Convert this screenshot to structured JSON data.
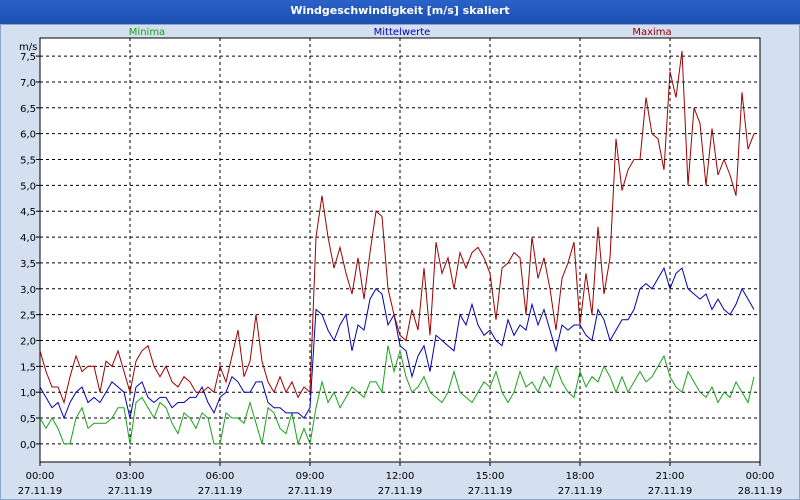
{
  "window": {
    "title": "Windgeschwindigkeit [m/s] skaliert"
  },
  "colors": {
    "minima": "#1aa31a",
    "mittelwerte": "#0000b8",
    "maxima": "#a00000",
    "grid": "#000000",
    "plot_bg": "#ffffff"
  },
  "chart_data": {
    "type": "line",
    "title": "Windgeschwindigkeit [m/s] skaliert",
    "ylabel": "m/s",
    "ylim": [
      -0.35,
      7.85
    ],
    "xlim": [
      0,
      24
    ],
    "yticks": [
      {
        "v": 0,
        "label": "0,0"
      },
      {
        "v": 0.5,
        "label": "0,5"
      },
      {
        "v": 1,
        "label": "1,0"
      },
      {
        "v": 1.5,
        "label": "1,5"
      },
      {
        "v": 2,
        "label": "2,0"
      },
      {
        "v": 2.5,
        "label": "2,5"
      },
      {
        "v": 3,
        "label": "3,0"
      },
      {
        "v": 3.5,
        "label": "3,5"
      },
      {
        "v": 4,
        "label": "4,0"
      },
      {
        "v": 4.5,
        "label": "4,5"
      },
      {
        "v": 5,
        "label": "5,0"
      },
      {
        "v": 5.5,
        "label": "5,5"
      },
      {
        "v": 6,
        "label": "6,0"
      },
      {
        "v": 6.5,
        "label": "6,5"
      },
      {
        "v": 7,
        "label": "7,0"
      },
      {
        "v": 7.5,
        "label": "7,5"
      }
    ],
    "xticks": [
      {
        "h": 0,
        "time": "00:00",
        "date": "27.11.19"
      },
      {
        "h": 3,
        "time": "03:00",
        "date": "27.11.19"
      },
      {
        "h": 6,
        "time": "06:00",
        "date": "27.11.19"
      },
      {
        "h": 9,
        "time": "09:00",
        "date": "27.11.19"
      },
      {
        "h": 12,
        "time": "12:00",
        "date": "27.11.19"
      },
      {
        "h": 15,
        "time": "15:00",
        "date": "27.11.19"
      },
      {
        "h": 18,
        "time": "18:00",
        "date": "27.11.19"
      },
      {
        "h": 21,
        "time": "21:00",
        "date": "27.11.19"
      },
      {
        "h": 24,
        "time": "00:00",
        "date": "28.11.19"
      }
    ],
    "grid": true,
    "series": [
      {
        "name": "Minima",
        "color": "#1aa31a",
        "legend_position": "left",
        "x": [
          0,
          0.2,
          0.4,
          0.6,
          0.8,
          1.0,
          1.2,
          1.4,
          1.6,
          1.8,
          2.0,
          2.2,
          2.4,
          2.6,
          2.8,
          3.0,
          3.2,
          3.4,
          3.6,
          3.8,
          4.0,
          4.2,
          4.4,
          4.6,
          4.8,
          5.0,
          5.2,
          5.4,
          5.6,
          5.8,
          6.0,
          6.2,
          6.4,
          6.6,
          6.8,
          7.0,
          7.2,
          7.4,
          7.6,
          7.8,
          8.0,
          8.2,
          8.4,
          8.6,
          8.8,
          9.0,
          9.2,
          9.4,
          9.6,
          9.8,
          10.0,
          10.2,
          10.4,
          10.6,
          10.8,
          11.0,
          11.2,
          11.4,
          11.6,
          11.8,
          12.0,
          12.2,
          12.4,
          12.6,
          12.8,
          13.0,
          13.2,
          13.4,
          13.6,
          13.8,
          14.0,
          14.2,
          14.4,
          14.6,
          14.8,
          15.0,
          15.2,
          15.4,
          15.6,
          15.8,
          16.0,
          16.2,
          16.4,
          16.6,
          16.8,
          17.0,
          17.2,
          17.4,
          17.6,
          17.8,
          18.0,
          18.2,
          18.4,
          18.6,
          18.8,
          19.0,
          19.2,
          19.4,
          19.6,
          19.8,
          20.0,
          20.2,
          20.4,
          20.6,
          20.8,
          21.0,
          21.2,
          21.4,
          21.6,
          21.8,
          22.0,
          22.2,
          22.4,
          22.6,
          22.8,
          23.0,
          23.2,
          23.4,
          23.6,
          23.8
        ],
        "values": [
          0.5,
          0.3,
          0.5,
          0.3,
          0.0,
          0.0,
          0.5,
          0.7,
          0.3,
          0.4,
          0.4,
          0.4,
          0.5,
          0.7,
          0.7,
          0.0,
          0.8,
          0.9,
          0.7,
          0.5,
          0.8,
          0.7,
          0.4,
          0.2,
          0.6,
          0.5,
          0.3,
          0.6,
          0.5,
          0.0,
          0.0,
          0.6,
          0.5,
          0.5,
          0.4,
          0.8,
          0.4,
          0.0,
          0.7,
          0.6,
          0.3,
          0.2,
          0.6,
          0.0,
          0.3,
          0.0,
          0.7,
          1.2,
          0.8,
          1.0,
          0.7,
          0.9,
          1.1,
          1.0,
          0.9,
          1.2,
          1.2,
          1.0,
          1.9,
          1.4,
          1.8,
          1.3,
          1.0,
          1.1,
          1.3,
          1.0,
          0.9,
          0.8,
          1.0,
          1.4,
          1.0,
          0.9,
          0.8,
          1.0,
          1.2,
          1.1,
          1.4,
          1.0,
          0.8,
          1.0,
          1.4,
          1.1,
          1.2,
          1.0,
          1.3,
          1.1,
          1.5,
          1.2,
          1.0,
          0.9,
          1.4,
          1.1,
          1.3,
          1.2,
          1.5,
          1.3,
          1.0,
          1.3,
          1.0,
          1.2,
          1.4,
          1.2,
          1.3,
          1.5,
          1.7,
          1.3,
          1.1,
          1.0,
          1.4,
          1.2,
          1.0,
          0.9,
          1.1,
          0.8,
          1.0,
          0.9,
          1.2,
          1.0,
          0.8,
          1.3
        ]
      },
      {
        "name": "Mittelwerte",
        "color": "#0000b8",
        "legend_position": "center",
        "x": [
          0,
          0.2,
          0.4,
          0.6,
          0.8,
          1.0,
          1.2,
          1.4,
          1.6,
          1.8,
          2.0,
          2.2,
          2.4,
          2.6,
          2.8,
          3.0,
          3.2,
          3.4,
          3.6,
          3.8,
          4.0,
          4.2,
          4.4,
          4.6,
          4.8,
          5.0,
          5.2,
          5.4,
          5.6,
          5.8,
          6.0,
          6.2,
          6.4,
          6.6,
          6.8,
          7.0,
          7.2,
          7.4,
          7.6,
          7.8,
          8.0,
          8.2,
          8.4,
          8.6,
          8.8,
          9.0,
          9.2,
          9.4,
          9.6,
          9.8,
          10.0,
          10.2,
          10.4,
          10.6,
          10.8,
          11.0,
          11.2,
          11.4,
          11.6,
          11.8,
          12.0,
          12.2,
          12.4,
          12.6,
          12.8,
          13.0,
          13.2,
          13.4,
          13.6,
          13.8,
          14.0,
          14.2,
          14.4,
          14.6,
          14.8,
          15.0,
          15.2,
          15.4,
          15.6,
          15.8,
          16.0,
          16.2,
          16.4,
          16.6,
          16.8,
          17.0,
          17.2,
          17.4,
          17.6,
          17.8,
          18.0,
          18.2,
          18.4,
          18.6,
          18.8,
          19.0,
          19.2,
          19.4,
          19.6,
          19.8,
          20.0,
          20.2,
          20.4,
          20.6,
          20.8,
          21.0,
          21.2,
          21.4,
          21.6,
          21.8,
          22.0,
          22.2,
          22.4,
          22.6,
          22.8,
          23.0,
          23.2,
          23.4,
          23.6,
          23.8
        ],
        "values": [
          1.1,
          0.9,
          0.7,
          0.8,
          0.5,
          0.8,
          1.0,
          1.1,
          0.8,
          0.9,
          0.8,
          1.0,
          1.2,
          1.1,
          1.0,
          0.5,
          1.1,
          1.2,
          0.9,
          0.8,
          0.9,
          0.9,
          0.7,
          0.8,
          0.8,
          0.9,
          0.9,
          1.1,
          0.8,
          0.6,
          0.9,
          1.0,
          1.3,
          1.2,
          1.0,
          1.0,
          1.2,
          1.2,
          0.8,
          0.7,
          0.7,
          0.6,
          0.6,
          0.6,
          0.5,
          0.7,
          2.6,
          2.5,
          2.2,
          2.0,
          2.3,
          2.5,
          1.8,
          2.3,
          2.2,
          2.8,
          3.0,
          2.9,
          2.3,
          2.5,
          1.9,
          1.8,
          1.3,
          1.7,
          1.9,
          1.4,
          2.1,
          2.0,
          1.9,
          1.8,
          2.5,
          2.3,
          2.7,
          2.3,
          2.1,
          2.2,
          2.0,
          1.9,
          2.4,
          2.1,
          2.3,
          2.2,
          2.7,
          2.3,
          2.6,
          2.2,
          1.8,
          2.3,
          2.2,
          2.3,
          2.3,
          2.1,
          2.0,
          2.6,
          2.4,
          2.0,
          2.2,
          2.4,
          2.4,
          2.6,
          3.0,
          3.1,
          3.0,
          3.2,
          3.4,
          3.0,
          3.3,
          3.4,
          3.0,
          2.9,
          2.8,
          2.9,
          2.6,
          2.8,
          2.6,
          2.5,
          2.7,
          3.0,
          2.8,
          2.6
        ]
      },
      {
        "name": "Maxima",
        "color": "#a00000",
        "legend_position": "right",
        "x": [
          0,
          0.2,
          0.4,
          0.6,
          0.8,
          1.0,
          1.2,
          1.4,
          1.6,
          1.8,
          2.0,
          2.2,
          2.4,
          2.6,
          2.8,
          3.0,
          3.2,
          3.4,
          3.6,
          3.8,
          4.0,
          4.2,
          4.4,
          4.6,
          4.8,
          5.0,
          5.2,
          5.4,
          5.6,
          5.8,
          6.0,
          6.2,
          6.4,
          6.6,
          6.8,
          7.0,
          7.2,
          7.4,
          7.6,
          7.8,
          8.0,
          8.2,
          8.4,
          8.6,
          8.8,
          9.0,
          9.2,
          9.4,
          9.6,
          9.8,
          10.0,
          10.2,
          10.4,
          10.6,
          10.8,
          11.0,
          11.2,
          11.4,
          11.6,
          11.8,
          12.0,
          12.2,
          12.4,
          12.6,
          12.8,
          13.0,
          13.2,
          13.4,
          13.6,
          13.8,
          14.0,
          14.2,
          14.4,
          14.6,
          14.8,
          15.0,
          15.2,
          15.4,
          15.6,
          15.8,
          16.0,
          16.2,
          16.4,
          16.6,
          16.8,
          17.0,
          17.2,
          17.4,
          17.6,
          17.8,
          18.0,
          18.2,
          18.4,
          18.6,
          18.8,
          19.0,
          19.2,
          19.4,
          19.6,
          19.8,
          20.0,
          20.2,
          20.4,
          20.6,
          20.8,
          21.0,
          21.2,
          21.4,
          21.6,
          21.8,
          22.0,
          22.2,
          22.4,
          22.6,
          22.8,
          23.0,
          23.2,
          23.4,
          23.6,
          23.8
        ],
        "values": [
          1.8,
          1.4,
          1.1,
          1.1,
          0.8,
          1.3,
          1.7,
          1.4,
          1.5,
          1.5,
          1.0,
          1.6,
          1.5,
          1.8,
          1.4,
          1.0,
          1.6,
          1.8,
          1.9,
          1.5,
          1.3,
          1.5,
          1.2,
          1.1,
          1.3,
          1.2,
          1.0,
          1.0,
          1.1,
          1.0,
          1.5,
          1.2,
          1.7,
          2.2,
          1.3,
          1.6,
          2.5,
          1.6,
          1.2,
          1.0,
          1.3,
          1.0,
          1.2,
          0.9,
          1.1,
          1.0,
          4.0,
          4.8,
          4.0,
          3.4,
          3.8,
          3.3,
          2.9,
          3.6,
          2.8,
          3.7,
          4.5,
          4.4,
          3.0,
          2.5,
          2.1,
          2.0,
          2.6,
          2.2,
          3.4,
          2.1,
          3.9,
          3.3,
          3.6,
          3.0,
          3.7,
          3.4,
          3.7,
          3.8,
          3.6,
          3.3,
          2.4,
          3.4,
          3.5,
          3.7,
          3.6,
          2.5,
          4.0,
          3.2,
          3.6,
          3.0,
          2.2,
          3.2,
          3.5,
          3.9,
          2.3,
          3.3,
          2.5,
          4.2,
          2.9,
          3.6,
          5.9,
          4.9,
          5.3,
          5.5,
          5.5,
          6.7,
          6.0,
          5.9,
          5.3,
          7.2,
          6.7,
          7.6,
          5.0,
          6.5,
          6.2,
          5.0,
          6.1,
          5.2,
          5.5,
          5.2,
          4.8,
          6.8,
          5.7,
          6.0
        ]
      }
    ]
  }
}
